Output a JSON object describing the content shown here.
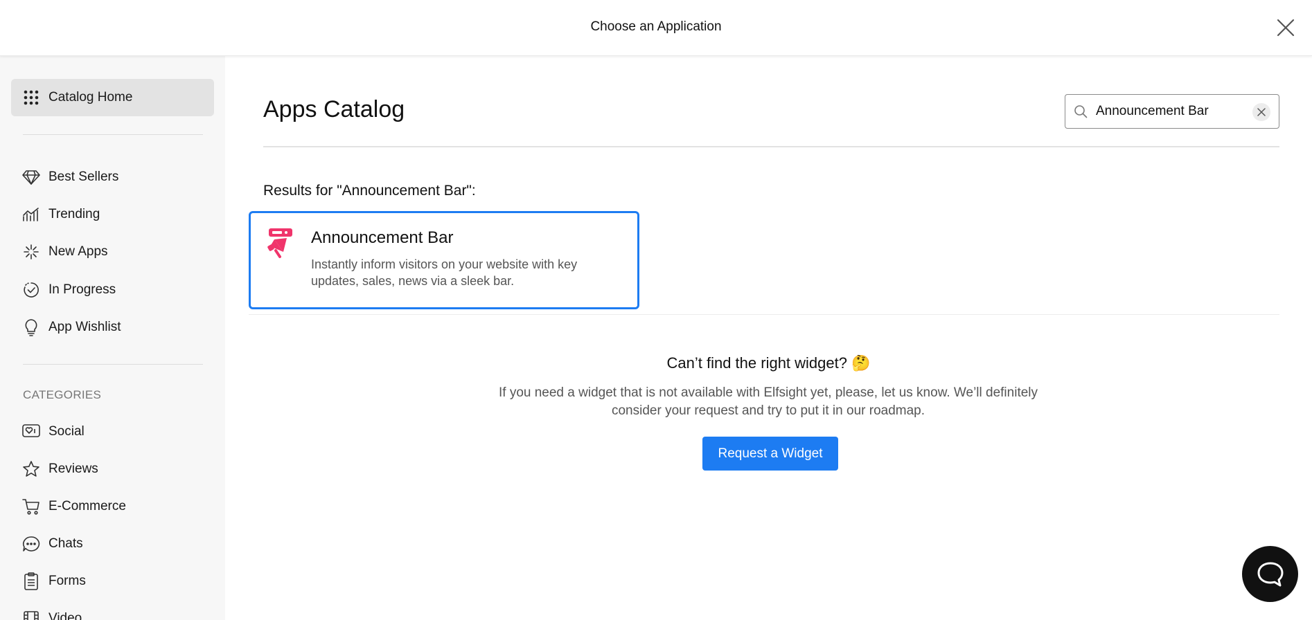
{
  "header": {
    "title": "Choose an Application"
  },
  "sidebar": {
    "home": {
      "label": "Catalog Home",
      "icon": "grid-icon"
    },
    "items": [
      {
        "label": "Best Sellers",
        "icon": "diamond-icon"
      },
      {
        "label": "Trending",
        "icon": "trending-icon"
      },
      {
        "label": "New Apps",
        "icon": "sparkle-icon"
      },
      {
        "label": "In Progress",
        "icon": "progress-check-icon"
      },
      {
        "label": "App Wishlist",
        "icon": "lightbulb-icon"
      }
    ],
    "categories_heading": "CATEGORIES",
    "categories": [
      {
        "label": "Social",
        "icon": "heart-chat-icon"
      },
      {
        "label": "Reviews",
        "icon": "star-icon"
      },
      {
        "label": "E-Commerce",
        "icon": "cart-icon"
      },
      {
        "label": "Chats",
        "icon": "chat-bubble-icon"
      },
      {
        "label": "Forms",
        "icon": "clipboard-icon"
      },
      {
        "label": "Video",
        "icon": "film-icon"
      }
    ]
  },
  "main": {
    "title": "Apps Catalog",
    "search": {
      "value": "Announcement Bar",
      "placeholder": ""
    },
    "results_label": "Results for \"Announcement Bar\":",
    "results": [
      {
        "name": "Announcement Bar",
        "description": "Instantly inform visitors on your website with key updates, sales, news via a sleek bar.",
        "icon": "megaphone-icon",
        "icon_color": "#f0346b"
      }
    ],
    "cta": {
      "title": "Can’t find the right widget? 🤔",
      "description": "If you need a widget that is not available with Elfsight yet, please, let us know. We’ll definitely consider your request and try to put it in our roadmap.",
      "button_label": "Request a Widget"
    }
  },
  "colors": {
    "accent": "#1d7cf2",
    "sidebar_bg": "#f7f7f7",
    "active_item_bg": "#e3e3e3",
    "app_icon": "#f0346b"
  }
}
